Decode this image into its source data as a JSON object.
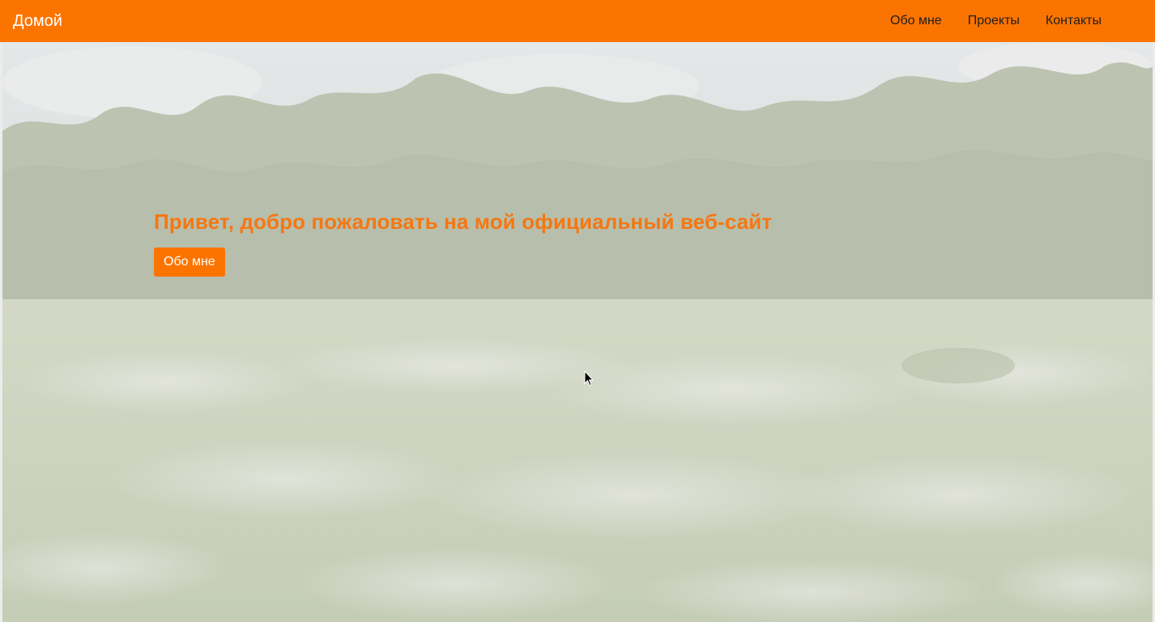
{
  "navbar": {
    "brand": "Домой",
    "links": [
      "Обо мне",
      "Проекты",
      "Контакты"
    ],
    "background_color": "#fc7400"
  },
  "hero": {
    "title": "Привет, добро пожаловать на мой официальный веб-сайт",
    "button_label": "Обо мне",
    "title_color": "#f57712",
    "button_color": "#fc7400"
  }
}
